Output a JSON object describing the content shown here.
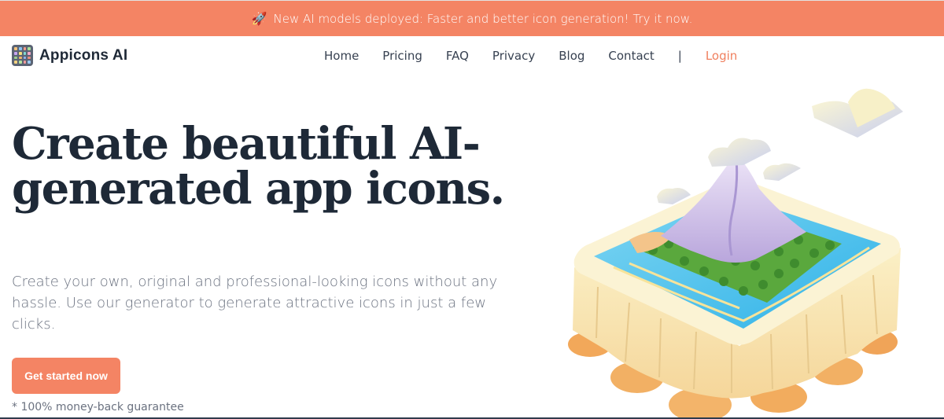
{
  "announcement": {
    "icon": "rocket-icon",
    "text": "New AI models deployed: Faster and better icon generation! Try it now."
  },
  "brand": {
    "name": "Appicons AI",
    "logo": "app-grid-logo"
  },
  "nav": {
    "items": [
      "Home",
      "Pricing",
      "FAQ",
      "Privacy",
      "Blog",
      "Contact"
    ],
    "separator": "|",
    "login": "Login"
  },
  "hero": {
    "title": "Create beautiful AI-generated app icons.",
    "subtitle": "Create your own, original and professional-looking icons without any hassle. Use our generator to generate attractive icons in just a few clicks.",
    "cta": "Get started now",
    "guarantee": "* 100% money-back guarantee"
  },
  "colors": {
    "accent": "#f48464",
    "heading": "#1e2937",
    "body_text": "#6b7280"
  }
}
